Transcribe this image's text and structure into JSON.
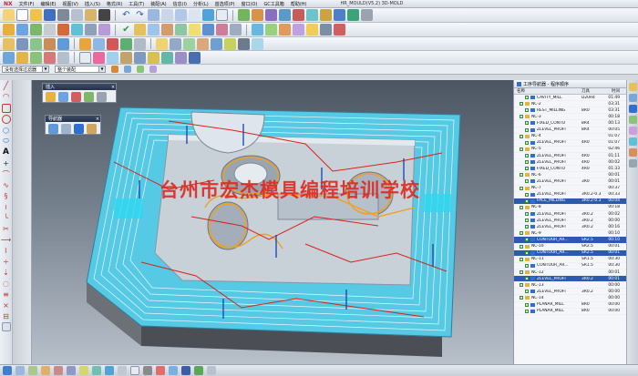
{
  "menu": {
    "logo": "NX",
    "items": [
      "文件(F)",
      "编辑(E)",
      "视图(V)",
      "插入(S)",
      "格式(R)",
      "工具(T)",
      "装配(A)",
      "信息(I)",
      "分析(L)",
      "首选项(P)",
      "窗口(O)",
      "GC工具箱",
      "帮助(H)"
    ],
    "title": "HR_MOULD(V5.2)   3D-MOLD"
  },
  "filter": {
    "type_value": "没有选择过滤器",
    "scope_value": "整个装配"
  },
  "palettes": {
    "insert_title": "插入",
    "nav_title": "导航器"
  },
  "watermark": "台州市宏杰模具编程培训学校",
  "navigator": {
    "title": "工序导航器 - 程序顺序",
    "col_name": "名称",
    "col_tool": "刀具",
    "col_time": "时间",
    "rows": [
      {
        "name": "CAVITY_MILL",
        "tool": "D20R4",
        "time": "01:49",
        "level": 2,
        "kind": "op",
        "selected": false
      },
      {
        "name": "NC-2",
        "tool": "",
        "time": "03:31",
        "level": 1,
        "kind": "group",
        "selected": false
      },
      {
        "name": "REST_MILLING",
        "tool": "8R0",
        "time": "03:31",
        "level": 2,
        "kind": "op",
        "selected": false
      },
      {
        "name": "NC-3",
        "tool": "",
        "time": "00:18",
        "level": 1,
        "kind": "group",
        "selected": false
      },
      {
        "name": "FIXED_CONTO",
        "tool": "8R4",
        "time": "00:13",
        "level": 2,
        "kind": "op",
        "selected": false
      },
      {
        "name": "ZLEVEL_PROFI",
        "tool": "8R4",
        "time": "00:05",
        "level": 2,
        "kind": "op",
        "selected": false
      },
      {
        "name": "NC-4",
        "tool": "",
        "time": "01:07",
        "level": 1,
        "kind": "group",
        "selected": false
      },
      {
        "name": "ZLEVEL_PROFI",
        "tool": "4R0",
        "time": "01:07",
        "level": 2,
        "kind": "op",
        "selected": false
      },
      {
        "name": "NC-5",
        "tool": "",
        "time": "02:46",
        "level": 1,
        "kind": "group",
        "selected": false
      },
      {
        "name": "ZLEVEL_PROFI",
        "tool": "4R0",
        "time": "01:11",
        "level": 2,
        "kind": "op",
        "selected": false
      },
      {
        "name": "ZLEVEL_PROFI",
        "tool": "4R0",
        "time": "00:02",
        "level": 2,
        "kind": "op",
        "selected": false
      },
      {
        "name": "FIXED_CONTO",
        "tool": "4R0",
        "time": "01:33",
        "level": 2,
        "kind": "op",
        "selected": false
      },
      {
        "name": "NC-6",
        "tool": "",
        "time": "00:01",
        "level": 1,
        "kind": "group",
        "selected": false
      },
      {
        "name": "ZLEVEL_PROFI",
        "tool": "3R0",
        "time": "00:01",
        "level": 2,
        "kind": "op",
        "selected": false
      },
      {
        "name": "NC-7",
        "tool": "",
        "time": "00:37",
        "level": 1,
        "kind": "group",
        "selected": false
      },
      {
        "name": "ZLEVEL_PROFI",
        "tool": "3R0.2-0.3",
        "time": "00:33",
        "level": 2,
        "kind": "op",
        "selected": false
      },
      {
        "name": "FACE_MILLING",
        "tool": "3R0.2-0.3",
        "time": "00:04",
        "level": 2,
        "kind": "op",
        "selected": true
      },
      {
        "name": "NC-8",
        "tool": "",
        "time": "00:18",
        "level": 1,
        "kind": "group",
        "selected": false
      },
      {
        "name": "ZLEVEL_PROFI",
        "tool": "3R0.2",
        "time": "00:02",
        "level": 2,
        "kind": "op",
        "selected": false
      },
      {
        "name": "ZLEVEL_PROFI",
        "tool": "3R0.2",
        "time": "00:00",
        "level": 2,
        "kind": "op",
        "selected": false
      },
      {
        "name": "ZLEVEL_PROFI",
        "tool": "3R0.2",
        "time": "00:16",
        "level": 2,
        "kind": "op",
        "selected": false
      },
      {
        "name": "NC-9",
        "tool": "",
        "time": "00:10",
        "level": 1,
        "kind": "group",
        "selected": false
      },
      {
        "name": "CONTOUR_AR...",
        "tool": "SR2.5",
        "time": "00:10",
        "level": 2,
        "kind": "op",
        "selected": true
      },
      {
        "name": "NC-10",
        "tool": "SR2.5",
        "time": "00:01",
        "level": 1,
        "kind": "group",
        "selected": false
      },
      {
        "name": "CONTOUR_AR...",
        "tool": "SR2.5",
        "time": "00:01",
        "level": 2,
        "kind": "op",
        "selected": true
      },
      {
        "name": "NC-11",
        "tool": "SR1.5",
        "time": "00:30",
        "level": 1,
        "kind": "group",
        "selected": false
      },
      {
        "name": "CONTOUR_AR...",
        "tool": "SR1.5",
        "time": "00:30",
        "level": 2,
        "kind": "op",
        "selected": false
      },
      {
        "name": "NC-12",
        "tool": "",
        "time": "00:01",
        "level": 1,
        "kind": "group",
        "selected": false
      },
      {
        "name": "ZLEVEL_PROFI",
        "tool": "3R0.2",
        "time": "00:01",
        "level": 2,
        "kind": "op",
        "selected": true
      },
      {
        "name": "NC-13",
        "tool": "",
        "time": "00:00",
        "level": 1,
        "kind": "group",
        "selected": false
      },
      {
        "name": "ZLEVEL_PROFI",
        "tool": "3R0.2",
        "time": "00:00",
        "level": 2,
        "kind": "op",
        "selected": false
      },
      {
        "name": "NC-14",
        "tool": "",
        "time": "00:00",
        "level": 1,
        "kind": "group",
        "selected": false
      },
      {
        "name": "PLANAR_MILL",
        "tool": "8R0",
        "time": "00:00",
        "level": 2,
        "kind": "op",
        "selected": false
      },
      {
        "name": "PLANAR_MILL",
        "tool": "8R0",
        "time": "00:00",
        "level": 2,
        "kind": "op",
        "selected": false
      }
    ]
  },
  "colors": {
    "accent": "#2a5bb0",
    "watermark": "#e0271e",
    "part_cyan": "#56c9e4",
    "toolpath_orange": "#f0a020",
    "toolpath_red": "#d8241c"
  }
}
